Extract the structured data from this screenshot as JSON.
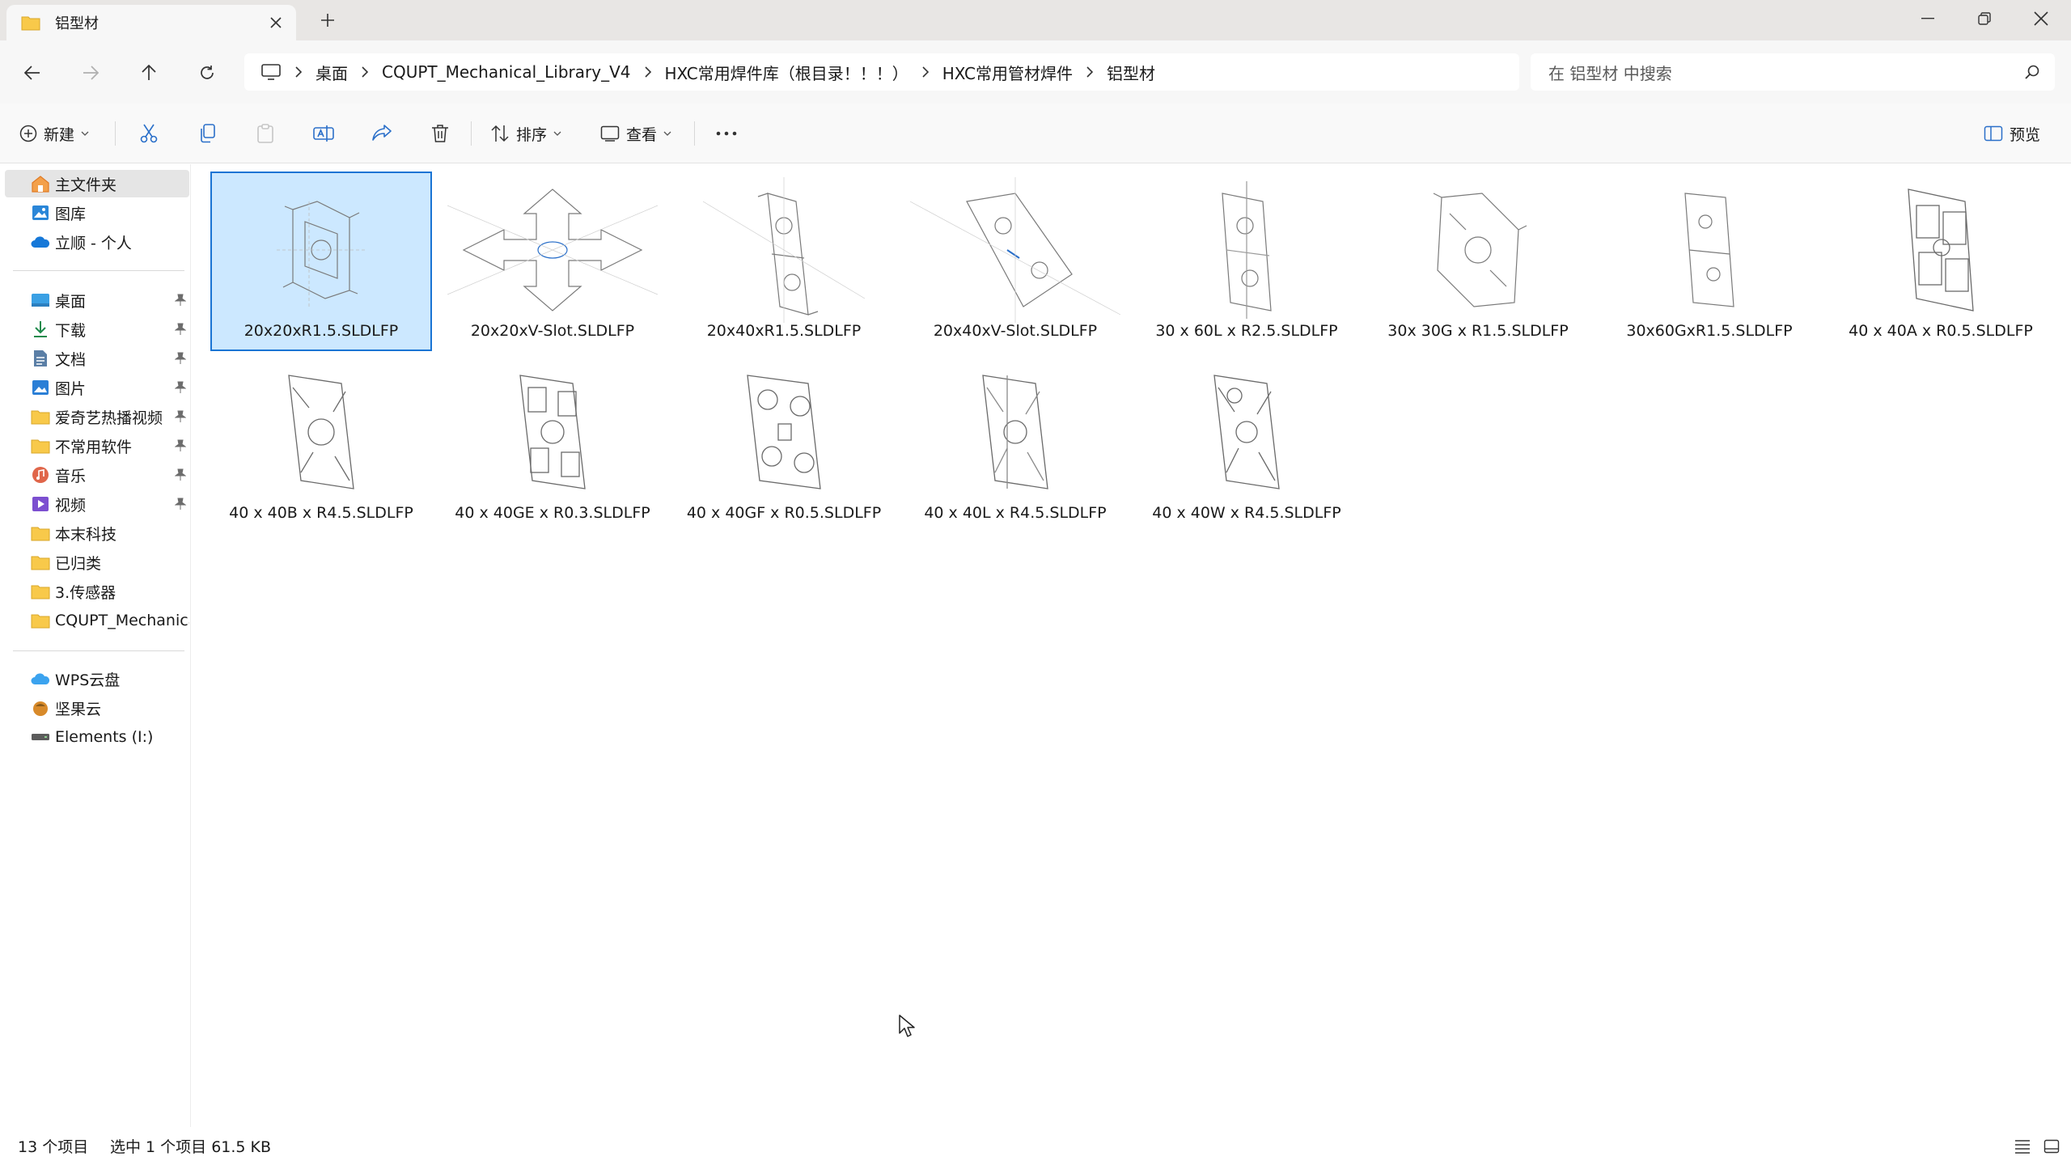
{
  "window": {
    "tab_title": "铝型材",
    "new_tab": "+"
  },
  "nav": {
    "breadcrumbs": [
      "桌面",
      "CQUPT_Mechanical_Library_V4",
      "HXC常用焊件库（根目录！！！）",
      "HXC常用管材焊件",
      "铝型材"
    ],
    "search_placeholder": "在 铝型材 中搜索"
  },
  "toolbar": {
    "new_label": "新建",
    "sort_label": "排序",
    "view_label": "查看",
    "more_label": "···",
    "preview_label": "预览"
  },
  "sidebar": {
    "top": [
      {
        "label": "主文件夹",
        "icon": "home-icon",
        "selected": true
      },
      {
        "label": "图库",
        "icon": "gallery-icon"
      },
      {
        "label": "立顺 - 个人",
        "icon": "onedrive-icon"
      }
    ],
    "pinned": [
      {
        "label": "桌面",
        "icon": "desktop-icon",
        "pinned": true
      },
      {
        "label": "下载",
        "icon": "download-icon",
        "pinned": true
      },
      {
        "label": "文档",
        "icon": "document-icon",
        "pinned": true
      },
      {
        "label": "图片",
        "icon": "picture-icon",
        "pinned": true
      },
      {
        "label": "爱奇艺热播视频",
        "icon": "folder-icon",
        "pinned": true
      },
      {
        "label": "不常用软件",
        "icon": "folder-icon",
        "pinned": true
      },
      {
        "label": "音乐",
        "icon": "music-icon",
        "pinned": true
      },
      {
        "label": "视频",
        "icon": "video-icon",
        "pinned": true
      },
      {
        "label": "本末科技",
        "icon": "folder-icon"
      },
      {
        "label": "已归类",
        "icon": "folder-icon"
      },
      {
        "label": "3.传感器",
        "icon": "folder-icon"
      },
      {
        "label": "CQUPT_Mechanical",
        "icon": "folder-icon"
      }
    ],
    "drives": [
      {
        "label": "WPS云盘",
        "icon": "wps-cloud-icon"
      },
      {
        "label": "坚果云",
        "icon": "jianguoyun-icon"
      },
      {
        "label": "Elements (I:)",
        "icon": "drive-icon"
      }
    ]
  },
  "files": [
    {
      "name": "20x20xR1.5.SLDLFP",
      "selected": true,
      "shape": "a"
    },
    {
      "name": "20x20xV-Slot.SLDLFP",
      "shape": "vslot"
    },
    {
      "name": "20x40xR1.5.SLDLFP",
      "shape": "tall"
    },
    {
      "name": "20x40xV-Slot.SLDLFP",
      "shape": "tallslot"
    },
    {
      "name": "30 x 60L x R2.5.SLDLFP",
      "shape": "tall"
    },
    {
      "name": "30x 30G x R1.5.SLDLFP",
      "shape": "a"
    },
    {
      "name": "30x60GxR1.5.SLDLFP",
      "shape": "tall"
    },
    {
      "name": "40 x 40A x R0.5.SLDLFP",
      "shape": "grid"
    },
    {
      "name": "40 x 40B x R4.5.SLDLFP",
      "shape": "a"
    },
    {
      "name": "40 x 40GE x R0.3.SLDLFP",
      "shape": "grid"
    },
    {
      "name": "40 x 40GF x R0.5.SLDLFP",
      "shape": "grid"
    },
    {
      "name": "40 x 40L x R4.5.SLDLFP",
      "shape": "a"
    },
    {
      "name": "40 x 40W x R4.5.SLDLFP",
      "shape": "a"
    }
  ],
  "status": {
    "count": "13 个项目",
    "selection": "选中 1 个项目  61.5 KB"
  },
  "colors": {
    "selection_bg": "#cce8ff",
    "selection_border": "#1a74d4",
    "folder": "#f8c94a",
    "accent": "#0067c0"
  }
}
